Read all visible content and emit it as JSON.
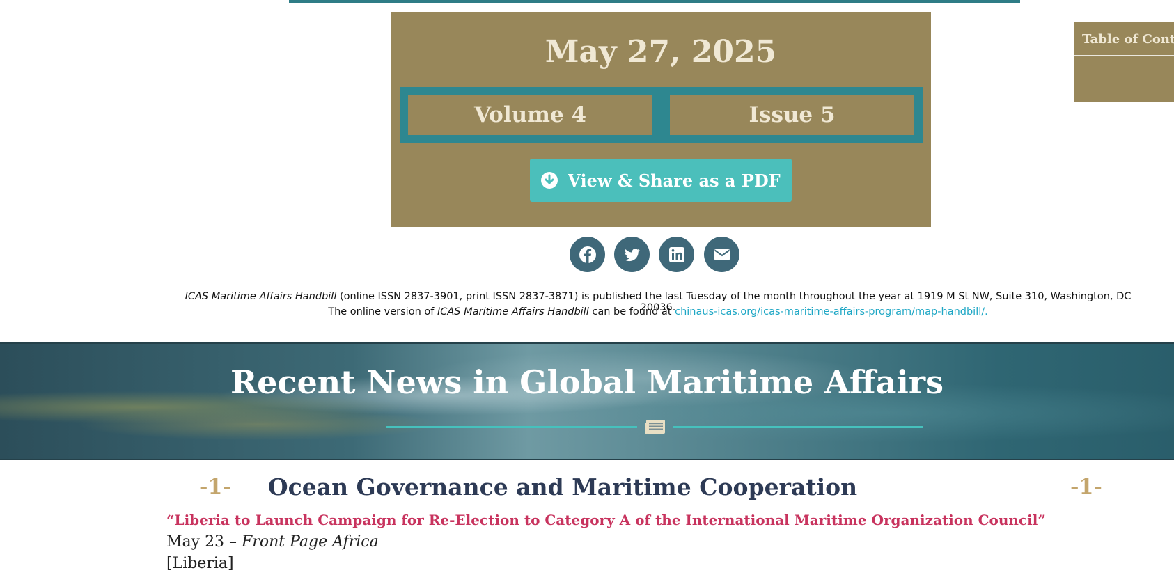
{
  "issue": {
    "date": "May 27, 2025",
    "volume": "Volume 4",
    "issue": "Issue 5",
    "pdf_button": "View & Share as a PDF"
  },
  "social": [
    {
      "icon": "facebook-icon"
    },
    {
      "icon": "twitter-icon"
    },
    {
      "icon": "linkedin-icon"
    },
    {
      "icon": "email-icon"
    }
  ],
  "publication": {
    "line1_title": "ICAS Maritime Affairs Handbill",
    "line1_text": " (online ISSN 2837-3901, print ISSN 2837-3871) is published the last Tuesday of the month throughout the year at 1919 M St NW, Suite 310, Washington, DC 20036.",
    "line2_prefix": "The online version of ",
    "line2_title": "ICAS Maritime Affairs Handbill",
    "line2_middle": " can be found at ",
    "line2_link": "chinaus-icas.org/icas-maritime-affairs-program/map-handbill/."
  },
  "toc": {
    "title": "Table of Contents"
  },
  "banner": {
    "title": "Recent News in Global Maritime Affairs",
    "icon": "newspaper-icon"
  },
  "section": {
    "number_left": "-1-",
    "number_right": "-1-",
    "title": "Ocean Governance and Maritime Cooperation"
  },
  "article": {
    "headline": "“Liberia to Launch Campaign for Re-Election to Category A of the International Maritime Organization Council”",
    "date": "May 23 – ",
    "source": "Front Page Africa",
    "country": "[Liberia]"
  },
  "colors": {
    "gold": "#98875a",
    "teal": "#2e8790",
    "button": "#4bbfbb",
    "headline": "#c8335e",
    "navy": "#2d3a55"
  }
}
